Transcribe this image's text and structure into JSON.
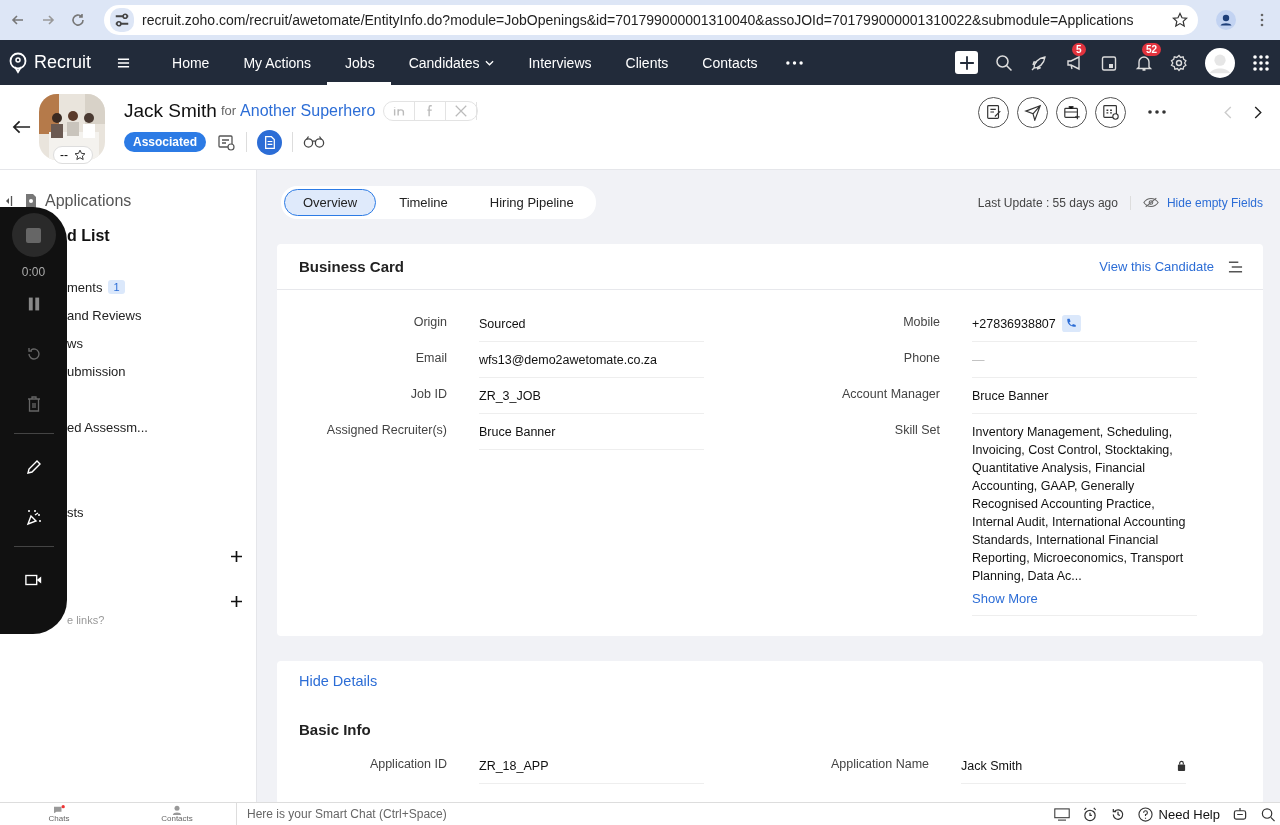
{
  "browser": {
    "url": "recruit.zoho.com/recruit/awetomate/EntityInfo.do?module=JobOpenings&id=701799000001310040&assoJOId=701799000001310022&submodule=Applications"
  },
  "nav": {
    "app_name": "Recruit",
    "items": [
      {
        "label": "Home",
        "selected": false,
        "dropdown": false
      },
      {
        "label": "My Actions",
        "selected": false,
        "dropdown": false
      },
      {
        "label": "Jobs",
        "selected": true,
        "dropdown": false
      },
      {
        "label": "Candidates",
        "selected": false,
        "dropdown": true
      },
      {
        "label": "Interviews",
        "selected": false,
        "dropdown": false
      },
      {
        "label": "Clients",
        "selected": false,
        "dropdown": false
      },
      {
        "label": "Contacts",
        "selected": false,
        "dropdown": false
      }
    ],
    "announcement_badge": "5",
    "notification_badge": "52"
  },
  "header": {
    "name": "Jack Smith",
    "for": "for",
    "job": "Another Superhero",
    "rating": "--",
    "status": "Associated"
  },
  "sidebar": {
    "title": "Applications",
    "items": [
      {
        "kind": "heading",
        "label": "d List"
      },
      {
        "kind": "item",
        "label": "ments",
        "badge": "1"
      },
      {
        "kind": "item",
        "label": "and Reviews"
      },
      {
        "kind": "item",
        "label": "ws"
      },
      {
        "kind": "item",
        "label": "ubmission"
      },
      {
        "kind": "item",
        "label": "ed Assessm..."
      },
      {
        "kind": "item",
        "label": "sts"
      },
      {
        "kind": "add"
      },
      {
        "kind": "add"
      },
      {
        "kind": "hint",
        "label": "e links?"
      }
    ]
  },
  "recorder": {
    "time": "0:00"
  },
  "tabs": [
    {
      "label": "Overview",
      "selected": true
    },
    {
      "label": "Timeline",
      "selected": false
    },
    {
      "label": "Hiring Pipeline",
      "selected": false
    }
  ],
  "last_update": "Last Update : 55 days ago",
  "hide_empty": "Hide empty Fields",
  "business_card": {
    "title": "Business Card",
    "link": "View this Candidate",
    "left_fields": [
      {
        "label": "Origin",
        "value": "Sourced"
      },
      {
        "label": "Email",
        "value": "wfs13@demo2awetomate.co.za"
      },
      {
        "label": "Job ID",
        "value": "ZR_3_JOB"
      },
      {
        "label": "Assigned Recruiter(s)",
        "value": "Bruce Banner"
      }
    ],
    "right_fields": [
      {
        "label": "Mobile",
        "value": "+27836938807",
        "kind": "phone"
      },
      {
        "label": "Phone",
        "value": "—",
        "kind": "empty"
      },
      {
        "label": "Account Manager",
        "value": "Bruce Banner",
        "kind": "text"
      },
      {
        "label": "Skill Set",
        "value": "Inventory Management, Scheduling, Invoicing, Cost Control, Stocktaking, Quantitative Analysis, Financial Accounting, GAAP, Generally Recognised Accounting Practice, Internal Audit, International Accounting Standards, International Financial Reporting, Microeconomics, Transport Planning, Data Ac...",
        "kind": "long",
        "more": "Show More"
      }
    ]
  },
  "hide_details": "Hide Details",
  "basic_info": {
    "title": "Basic Info",
    "fields": [
      {
        "label": "Application ID",
        "value": "ZR_18_APP",
        "locked": false
      },
      {
        "label": "Application Name",
        "value": "Jack Smith",
        "locked": true
      }
    ]
  },
  "bottom_bar": {
    "chats": "Chats",
    "contacts": "Contacts",
    "smart_chat_placeholder": "Here is your Smart Chat (Ctrl+Space)",
    "help": "Need Help"
  }
}
